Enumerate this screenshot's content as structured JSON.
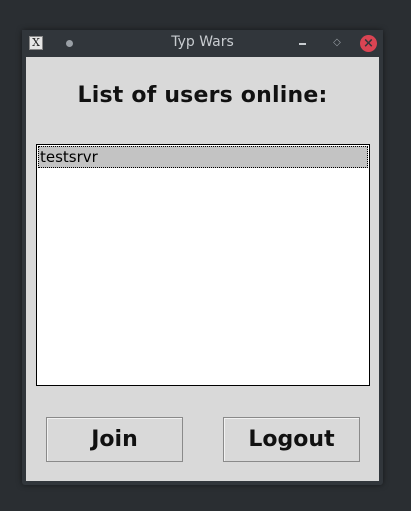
{
  "window": {
    "title": "Typ Wars",
    "icons": {
      "app": "x-app-icon",
      "pin": "pin-icon",
      "minimize": "minimize-icon",
      "maximize": "maximize-icon",
      "close": "close-icon"
    },
    "app_icon_glyph": "X",
    "close_glyph": "×",
    "maximize_glyph": "◇",
    "colors": {
      "titlebar": "#31363b",
      "close": "#da4453",
      "content_bg": "#d9d9d9",
      "selection": "#c3c3c3"
    }
  },
  "main": {
    "heading": "List of users online:",
    "users": [
      "testsrvr"
    ],
    "selected_index": 0
  },
  "buttons": {
    "join_label": "Join",
    "logout_label": "Logout"
  }
}
